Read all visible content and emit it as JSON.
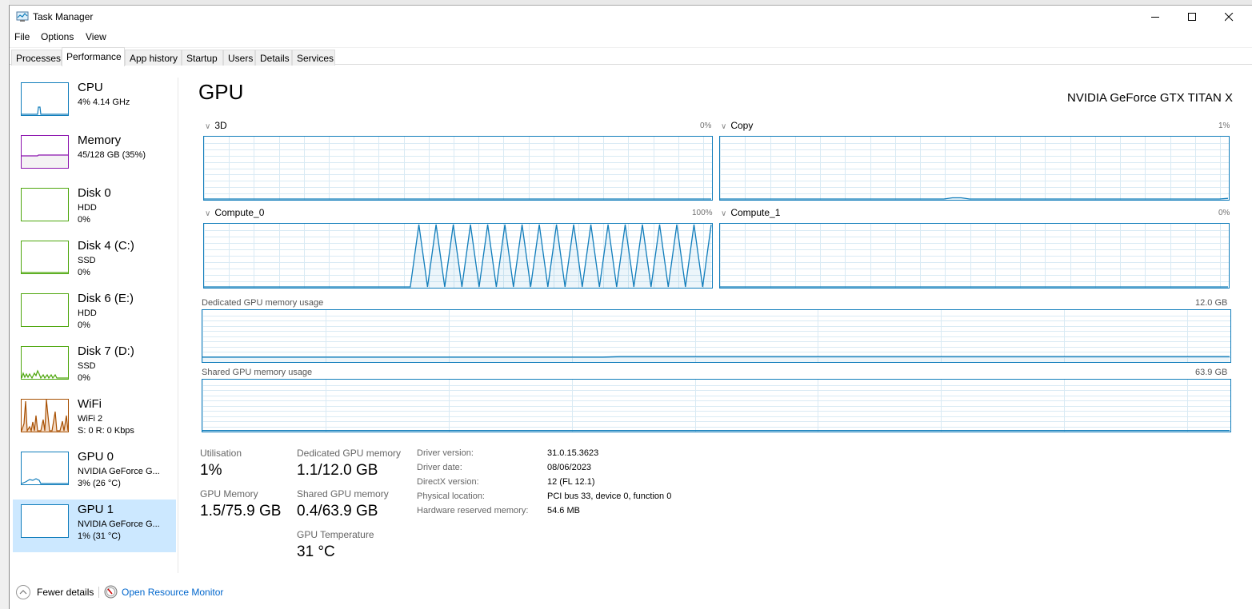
{
  "window": {
    "title": "Task Manager",
    "controls": {
      "minimize": "minimize-icon",
      "maximize": "maximize-icon",
      "close": "close-icon"
    }
  },
  "menu": [
    "File",
    "Options",
    "View"
  ],
  "tabs": [
    {
      "label": "Processes",
      "active": false
    },
    {
      "label": "Performance",
      "active": true
    },
    {
      "label": "App history",
      "active": false
    },
    {
      "label": "Startup",
      "active": false
    },
    {
      "label": "Users",
      "active": false
    },
    {
      "label": "Details",
      "active": false
    },
    {
      "label": "Services",
      "active": false
    }
  ],
  "sidebar": {
    "items": [
      {
        "name": "CPU",
        "line1": "4% 4.14 GHz",
        "line2": "",
        "color": "#117dbb",
        "selected": false
      },
      {
        "name": "Memory",
        "line1": "45/128 GB (35%)",
        "line2": "",
        "color": "#8b12ae",
        "selected": false
      },
      {
        "name": "Disk 0",
        "line1": "HDD",
        "line2": "0%",
        "color": "#4da60c",
        "selected": false
      },
      {
        "name": "Disk 4 (C:)",
        "line1": "SSD",
        "line2": "0%",
        "color": "#4da60c",
        "selected": false
      },
      {
        "name": "Disk 6 (E:)",
        "line1": "HDD",
        "line2": "0%",
        "color": "#4da60c",
        "selected": false
      },
      {
        "name": "Disk 7 (D:)",
        "line1": "SSD",
        "line2": "0%",
        "color": "#4da60c",
        "selected": false
      },
      {
        "name": "WiFi",
        "line1": "WiFi 2",
        "line2": "S: 0 R: 0 Kbps",
        "color": "#a74f01",
        "selected": false
      },
      {
        "name": "GPU 0",
        "line1": "NVIDIA GeForce G...",
        "line2": "3%  (26 °C)",
        "color": "#117dbb",
        "selected": false
      },
      {
        "name": "GPU 1",
        "line1": "NVIDIA GeForce G...",
        "line2": "1%  (31 °C)",
        "color": "#117dbb",
        "selected": true
      }
    ]
  },
  "main": {
    "title": "GPU",
    "model": "NVIDIA GeForce GTX TITAN X",
    "engines": [
      {
        "label": "3D",
        "percent": "0%"
      },
      {
        "label": "Copy",
        "percent": "1%"
      },
      {
        "label": "Compute_0",
        "percent": "100%"
      },
      {
        "label": "Compute_1",
        "percent": "0%"
      }
    ],
    "dedicated_memory_chart": {
      "label": "Dedicated GPU memory usage",
      "max": "12.0 GB"
    },
    "shared_memory_chart": {
      "label": "Shared GPU memory usage",
      "max": "63.9 GB"
    },
    "stats": {
      "utilisation_label": "Utilisation",
      "utilisation": "1%",
      "gpu_memory_label": "GPU Memory",
      "gpu_memory": "1.5/75.9 GB",
      "dedicated_label": "Dedicated GPU memory",
      "dedicated": "1.1/12.0 GB",
      "shared_label": "Shared GPU memory",
      "shared": "0.4/63.9 GB",
      "temp_label": "GPU Temperature",
      "temp": "31 °C"
    },
    "details": [
      {
        "label": "Driver version:",
        "value": "31.0.15.3623"
      },
      {
        "label": "Driver date:",
        "value": "08/06/2023"
      },
      {
        "label": "DirectX version:",
        "value": "12 (FL 12.1)"
      },
      {
        "label": "Physical location:",
        "value": "PCI bus 33, device 0, function 0"
      },
      {
        "label": "Hardware reserved memory:",
        "value": "54.6 MB"
      }
    ]
  },
  "footer": {
    "fewer_details": "Fewer details",
    "open_resource_monitor": "Open Resource Monitor"
  },
  "chart_data": [
    {
      "type": "line",
      "title": "3D",
      "ylim": [
        0,
        100
      ],
      "unit": "%",
      "values": [
        0,
        0,
        0,
        0,
        0,
        0,
        0,
        0,
        0,
        0,
        0,
        0,
        0,
        0,
        0,
        0,
        0,
        0,
        0,
        0,
        0,
        0,
        0,
        0,
        0,
        0,
        0,
        0,
        0,
        0,
        0,
        0,
        0,
        0,
        0,
        0,
        0,
        0,
        0,
        0,
        0,
        0,
        0,
        0,
        0,
        0,
        0,
        0,
        0,
        0,
        0,
        0,
        0,
        0,
        0,
        0,
        0,
        0,
        0,
        0
      ]
    },
    {
      "type": "line",
      "title": "Copy",
      "ylim": [
        0,
        100
      ],
      "unit": "%",
      "values": [
        0,
        0,
        0,
        0,
        0,
        0,
        0,
        0,
        0,
        0,
        0,
        0,
        0,
        0,
        0,
        0,
        0,
        0,
        0,
        0,
        0,
        0,
        0,
        0,
        0,
        0,
        0,
        2,
        2,
        0,
        0,
        0,
        0,
        0,
        0,
        0,
        0,
        0,
        0,
        0,
        0,
        0,
        0,
        0,
        0,
        0,
        0,
        0,
        0,
        0,
        0,
        0,
        0,
        0,
        0,
        0,
        0,
        0,
        0,
        1
      ]
    },
    {
      "type": "line",
      "title": "Compute_0",
      "ylim": [
        0,
        100
      ],
      "unit": "%",
      "values": [
        0,
        0,
        0,
        0,
        0,
        0,
        0,
        0,
        0,
        0,
        0,
        0,
        0,
        0,
        0,
        0,
        0,
        0,
        0,
        0,
        0,
        0,
        0,
        0,
        0,
        100,
        0,
        100,
        0,
        100,
        0,
        100,
        0,
        100,
        0,
        100,
        0,
        100,
        0,
        100,
        0,
        100,
        0,
        100,
        0,
        100,
        0,
        100,
        0,
        100,
        0,
        100,
        0,
        100,
        0,
        100,
        0,
        100,
        0,
        100
      ]
    },
    {
      "type": "line",
      "title": "Compute_1",
      "ylim": [
        0,
        100
      ],
      "unit": "%",
      "values": [
        0,
        0,
        0,
        0,
        0,
        0,
        0,
        0,
        0,
        0,
        0,
        0,
        0,
        0,
        0,
        0,
        0,
        0,
        0,
        0,
        0,
        0,
        0,
        0,
        0,
        0,
        0,
        0,
        0,
        0,
        0,
        0,
        0,
        0,
        0,
        0,
        0,
        0,
        0,
        0,
        0,
        0,
        0,
        0,
        0,
        0,
        0,
        0,
        0,
        0,
        0,
        0,
        0,
        0,
        0,
        0,
        0,
        0,
        0,
        0
      ]
    },
    {
      "type": "area",
      "title": "Dedicated GPU memory usage",
      "ylim": [
        0,
        12.0
      ],
      "unit": "GB",
      "values": [
        1.0,
        1.0,
        1.0,
        1.0,
        1.0,
        1.0,
        1.0,
        1.0,
        1.0,
        1.0,
        1.0,
        1.0,
        1.0,
        1.0,
        1.0,
        1.0,
        1.0,
        1.0,
        1.0,
        1.0,
        1.0,
        1.0,
        1.0,
        1.0,
        1.1,
        1.1,
        1.1,
        1.1,
        1.1,
        1.1,
        1.1,
        1.1,
        1.1,
        1.1,
        1.1,
        1.1,
        1.1,
        1.1,
        1.1,
        1.1,
        1.1,
        1.1,
        1.1,
        1.1,
        1.1,
        1.1,
        1.1,
        1.1,
        1.1,
        1.1,
        1.1,
        1.1,
        1.1,
        1.1,
        1.1,
        1.1,
        1.1,
        1.1,
        1.1,
        1.1
      ]
    },
    {
      "type": "area",
      "title": "Shared GPU memory usage",
      "ylim": [
        0,
        63.9
      ],
      "unit": "GB",
      "values": [
        0.4,
        0.4,
        0.4,
        0.4,
        0.4,
        0.4,
        0.4,
        0.4,
        0.4,
        0.4,
        0.4,
        0.4,
        0.4,
        0.4,
        0.4,
        0.4,
        0.4,
        0.4,
        0.4,
        0.4,
        0.4,
        0.4,
        0.4,
        0.4,
        0.4,
        0.4,
        0.4,
        0.4,
        0.4,
        0.4,
        0.4,
        0.4,
        0.4,
        0.4,
        0.4,
        0.4,
        0.4,
        0.4,
        0.4,
        0.4,
        0.4,
        0.4,
        0.4,
        0.4,
        0.4,
        0.4,
        0.4,
        0.4,
        0.4,
        0.4,
        0.4,
        0.4,
        0.4,
        0.4,
        0.4,
        0.4,
        0.4,
        0.4,
        0.4,
        0.4
      ]
    }
  ]
}
